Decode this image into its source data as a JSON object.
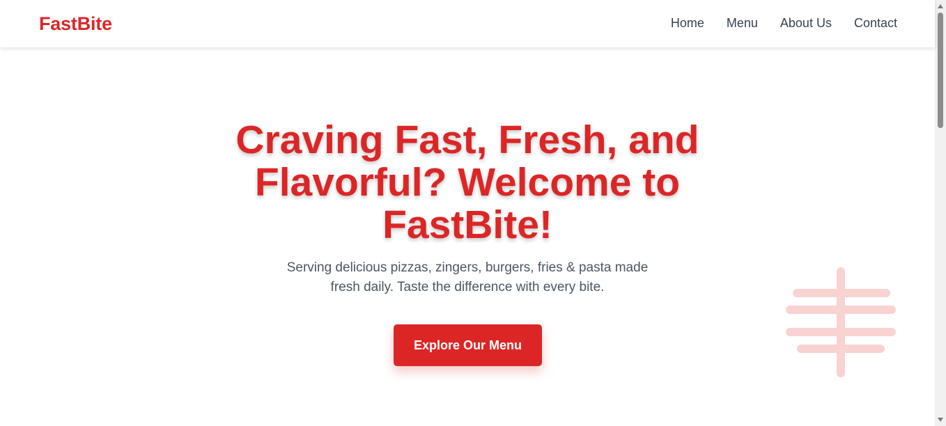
{
  "header": {
    "logo": "FastBite",
    "nav": [
      "Home",
      "Menu",
      "About Us",
      "Contact"
    ]
  },
  "hero": {
    "title": "Craving Fast, Fresh, and Flavorful? Welcome to FastBite!",
    "subtitle": "Serving delicious pizzas, zingers, burgers, fries & pasta made fresh daily. Taste the difference with every bite.",
    "cta_label": "Explore Our Menu"
  },
  "decor": {
    "icon": "fries-icon",
    "color": "#f9d2d2"
  },
  "colors": {
    "brand": "#dc2626",
    "nav_text": "#374151",
    "subtitle_text": "#4b5563"
  }
}
